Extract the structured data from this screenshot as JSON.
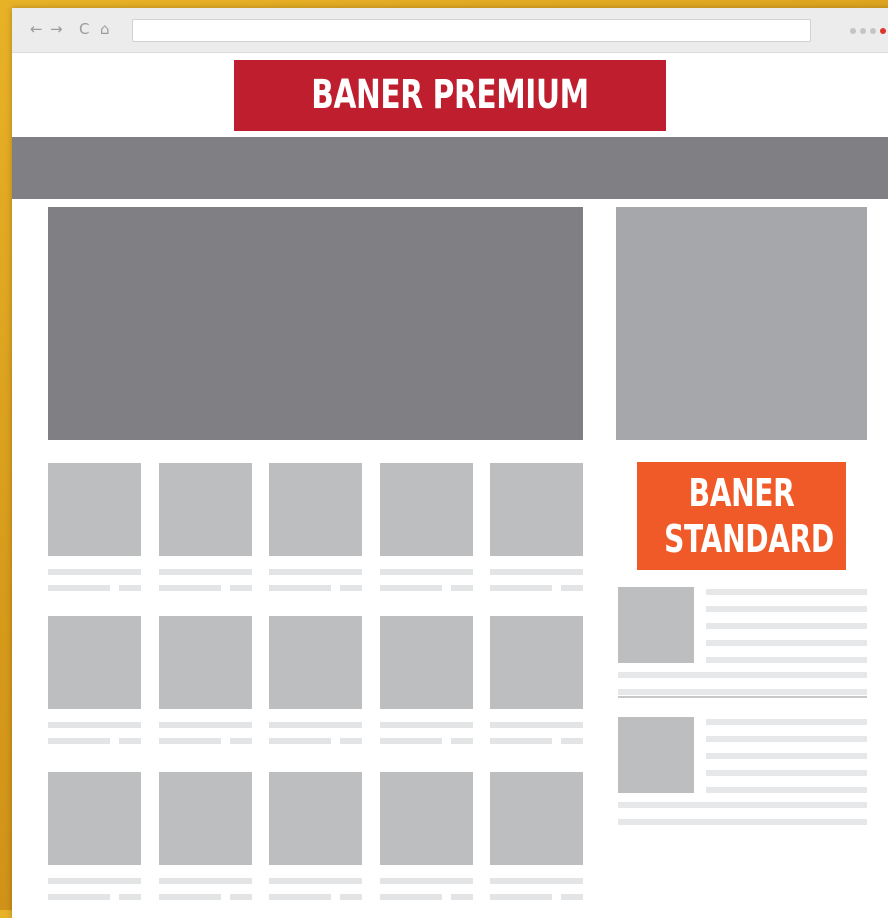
{
  "browser": {
    "nav_icons": [
      "back-arrow-icon",
      "forward-arrow-icon",
      "reload-icon",
      "home-icon"
    ],
    "nav_glyphs": {
      "back": "←",
      "forward": "→",
      "reload": "C",
      "home": "⌂"
    },
    "address_value": ""
  },
  "banners": {
    "premium": {
      "label": "BANER PREMIUM",
      "color": "#bf1e2e"
    },
    "standard": {
      "line1": "BANER",
      "line2": "STANDARD",
      "color": "#f05a28"
    }
  },
  "colors": {
    "background": "#d89c1c",
    "placeholder_dark": "#808084",
    "placeholder_mid": "#a5a7aa",
    "placeholder_light": "#bcbec0"
  },
  "layout_counts": {
    "grid_columns": 5,
    "grid_rows": 3,
    "sidebar_items": 2
  }
}
